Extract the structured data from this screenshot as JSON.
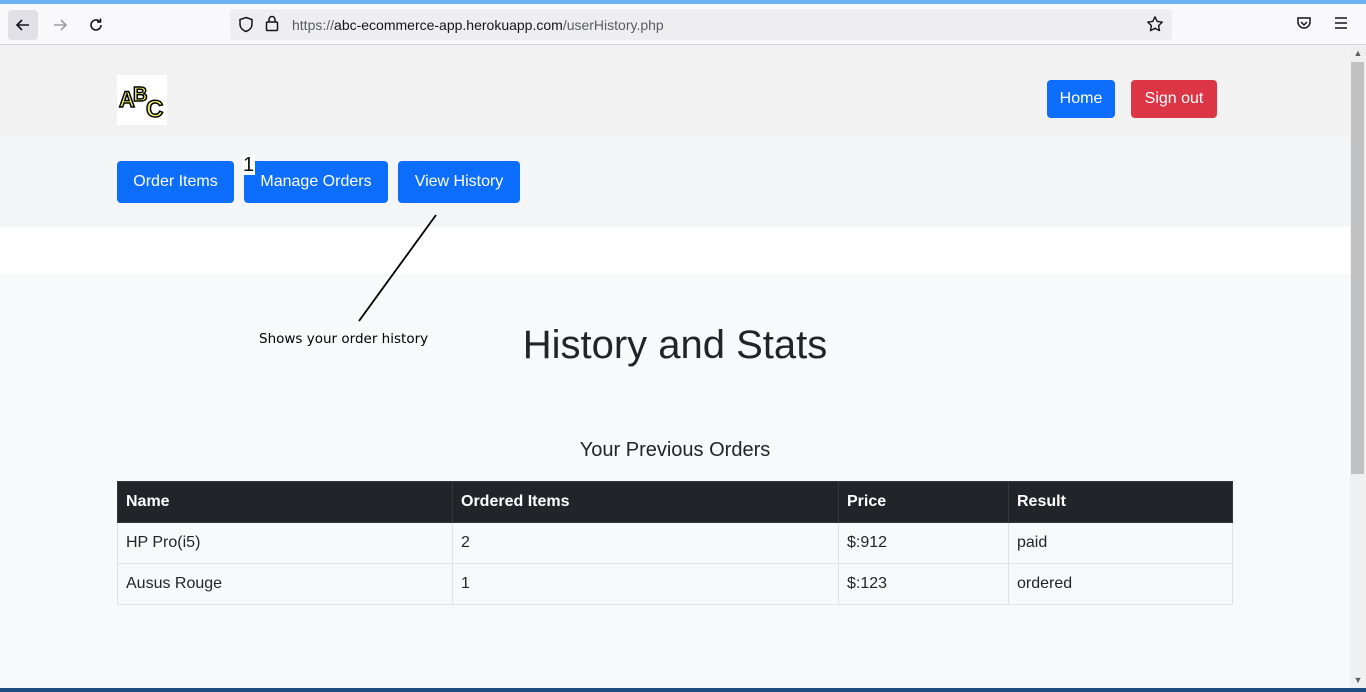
{
  "browser": {
    "url_prefix": "https://",
    "url_host": "abc-ecommerce-app.herokuapp.com",
    "url_path": "/userHistory.php",
    "icons": [
      "back-arrow-icon",
      "forward-arrow-icon",
      "reload-icon",
      "shield-icon",
      "lock-icon",
      "star-icon",
      "pocket-icon",
      "menu-icon"
    ]
  },
  "header": {
    "logo_text": "ABC",
    "home_label": "Home",
    "signout_label": "Sign out"
  },
  "subnav": {
    "order_items_label": "Order Items",
    "manage_orders_label": "Manage Orders",
    "view_history_label": "View History"
  },
  "annotation": {
    "number": "1",
    "text": "Shows your order history"
  },
  "main": {
    "title": "History and Stats",
    "subtitle": "Your Previous Orders"
  },
  "table": {
    "columns": [
      "Name",
      "Ordered Items",
      "Price",
      "Result"
    ],
    "rows": [
      [
        "HP Pro(i5)",
        "2",
        "$:912",
        "paid"
      ],
      [
        "Ausus Rouge",
        "1",
        "$:123",
        "ordered"
      ]
    ]
  },
  "colors": {
    "primary": "#0d6efd",
    "danger": "#dc3545",
    "table_header": "#212529"
  }
}
